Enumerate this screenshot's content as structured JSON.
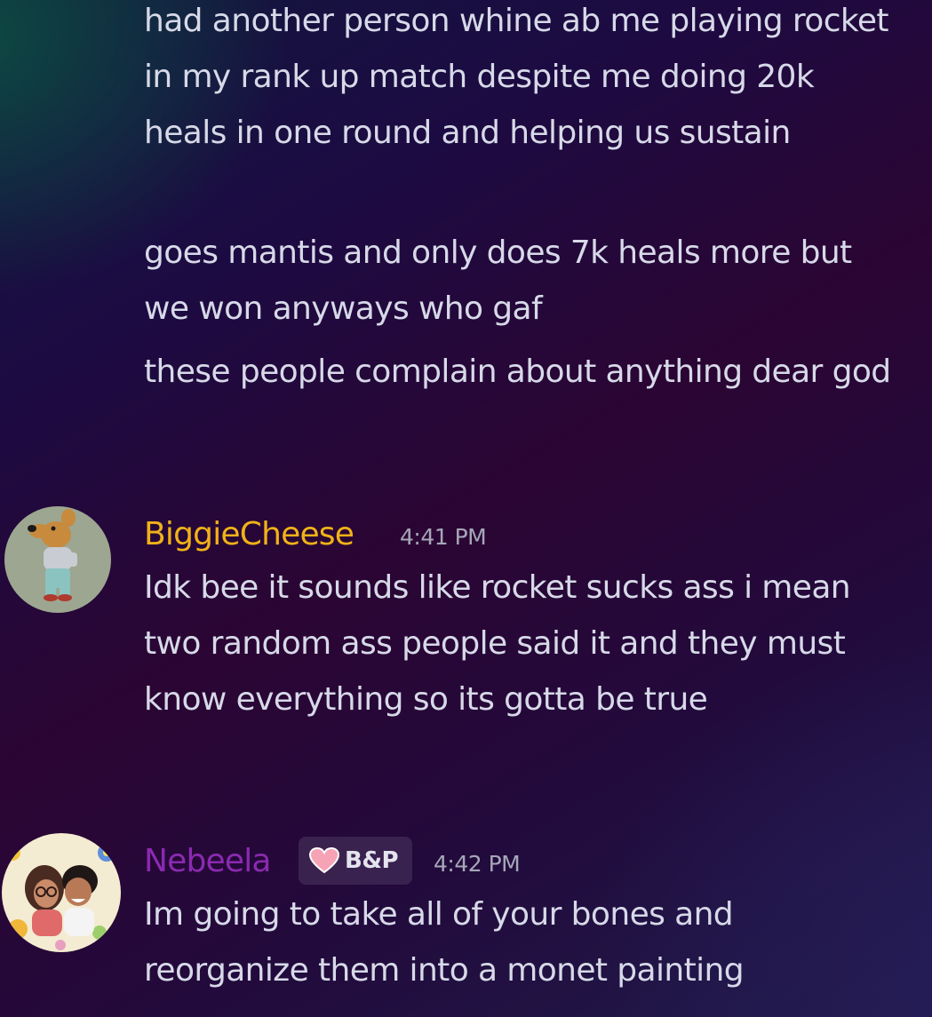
{
  "messages": [
    {
      "text": "had another person whine ab me playing rocket in my rank up match despite me doing 20k heals in one round and helping us sustain"
    },
    {
      "text": "goes mantis and only does 7k heals more but we won anyways who gaf"
    },
    {
      "text": "these people complain about anything dear god"
    }
  ],
  "biggie": {
    "username": "BiggieCheese",
    "color": "#f0b219",
    "timestamp": "4:41 PM",
    "text": "Idk bee it sounds like rocket sucks ass i mean two random ass people said it and they must know everything so its gotta be true"
  },
  "nebeela": {
    "username": "Nebeela",
    "color": "#8a2ab0",
    "timestamp": "4:42 PM",
    "tag": {
      "icon": "heart-icon",
      "label": "B&P"
    },
    "text": "Im going to take all of your bones and reorganize them into a monet painting"
  }
}
